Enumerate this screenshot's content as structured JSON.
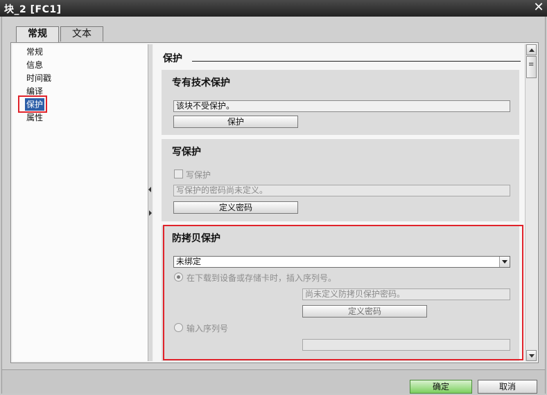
{
  "window": {
    "title": "块_2 [FC1]"
  },
  "tabs": [
    {
      "label": "常规",
      "active": true
    },
    {
      "label": "文本",
      "active": false
    }
  ],
  "nav": {
    "items": [
      {
        "label": "常规"
      },
      {
        "label": "信息"
      },
      {
        "label": "时间戳"
      },
      {
        "label": "编译"
      },
      {
        "label": "保护",
        "selected": true
      },
      {
        "label": "属性"
      }
    ]
  },
  "content": {
    "heading": "保护",
    "know_how": {
      "title": "专有技术保护",
      "status": "该块不受保护。",
      "button": "保护"
    },
    "write": {
      "title": "写保护",
      "checkbox_label": "写保护",
      "status": "写保护的密码尚未定义。",
      "button": "定义密码"
    },
    "copy": {
      "title": "防拷贝保护",
      "select_value": "未绑定",
      "radio1_label": "在下载到设备或存储卡时，插入序列号。",
      "password_status": "尚未定义防拷贝保护密码。",
      "button": "定义密码",
      "radio2_label": "输入序列号",
      "serial_value": ""
    }
  },
  "footer": {
    "ok": "确定",
    "cancel": "取消"
  },
  "colors": {
    "highlight_red": "#e0222a",
    "selected_blue": "#2d5fa8",
    "ok_green": "#7ccf5e"
  }
}
